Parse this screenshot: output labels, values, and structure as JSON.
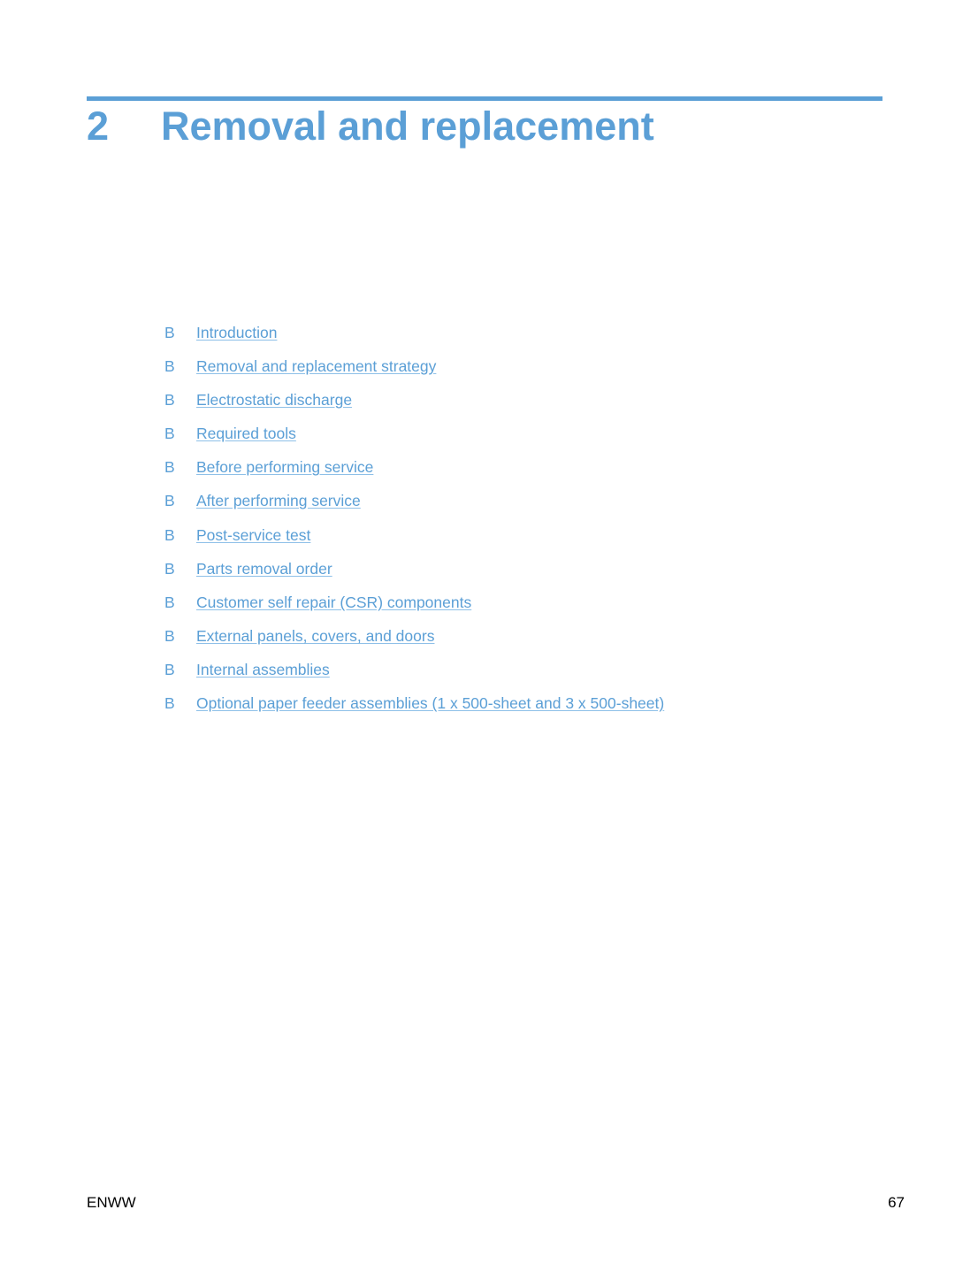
{
  "chapter": {
    "number": "2",
    "title": "Removal and replacement"
  },
  "toc": {
    "bullet": "B",
    "items": [
      {
        "label": "Introduction"
      },
      {
        "label": "Removal and replacement strategy"
      },
      {
        "label": "Electrostatic discharge"
      },
      {
        "label": "Required tools"
      },
      {
        "label": "Before performing service"
      },
      {
        "label": "After performing service"
      },
      {
        "label": "Post-service test"
      },
      {
        "label": "Parts removal order"
      },
      {
        "label": "Customer self repair (CSR) components"
      },
      {
        "label": "External panels, covers, and doors"
      },
      {
        "label": "Internal assemblies"
      },
      {
        "label": "Optional paper feeder assemblies (1 x 500-sheet and 3 x 500-sheet)"
      }
    ]
  },
  "footer": {
    "left": "ENWW",
    "page_number": "67"
  },
  "colors": {
    "accent": "#5b9fd6"
  }
}
